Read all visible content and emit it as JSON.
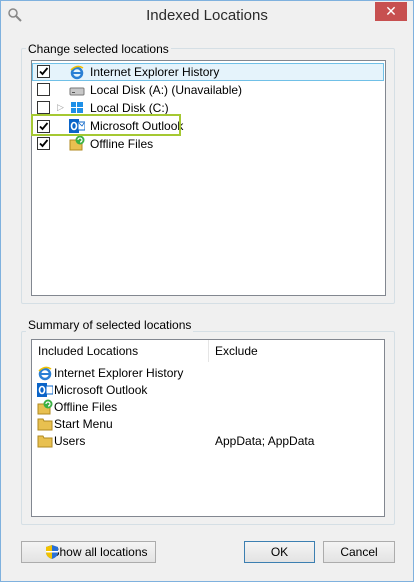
{
  "window": {
    "title": "Indexed Locations",
    "close_glyph": "✕"
  },
  "change_group": {
    "label": "Change selected locations",
    "items": [
      {
        "label": "Internet Explorer History",
        "checked": true,
        "icon": "internet-explorer-icon",
        "selected": true
      },
      {
        "label": "Local Disk (A:) (Unavailable)",
        "checked": false,
        "icon": "drive-icon"
      },
      {
        "label": "Local Disk (C:)",
        "checked": false,
        "icon": "windows-drive-icon",
        "expandable": true
      },
      {
        "label": "Microsoft Outlook",
        "checked": true,
        "icon": "outlook-icon",
        "highlighted": true
      },
      {
        "label": "Offline Files",
        "checked": true,
        "icon": "offline-files-icon"
      }
    ]
  },
  "summary_group": {
    "label": "Summary of selected locations",
    "columns": [
      "Included Locations",
      "Exclude"
    ],
    "rows": [
      {
        "location": "Internet Explorer History",
        "exclude": "",
        "icon": "internet-explorer-icon"
      },
      {
        "location": "Microsoft Outlook",
        "exclude": "",
        "icon": "outlook-icon"
      },
      {
        "location": "Offline Files",
        "exclude": "",
        "icon": "offline-files-icon"
      },
      {
        "location": "Start Menu",
        "exclude": "",
        "icon": "folder-icon"
      },
      {
        "location": "Users",
        "exclude": "AppData; AppData",
        "icon": "folder-icon"
      }
    ]
  },
  "buttons": {
    "show_all": "Show all locations",
    "ok": "OK",
    "cancel": "Cancel"
  },
  "colors": {
    "selection_bg": "#e5f3fb",
    "selection_border": "#70c0e7",
    "highlight_border": "#a5c832",
    "close_button": "#c75050"
  }
}
